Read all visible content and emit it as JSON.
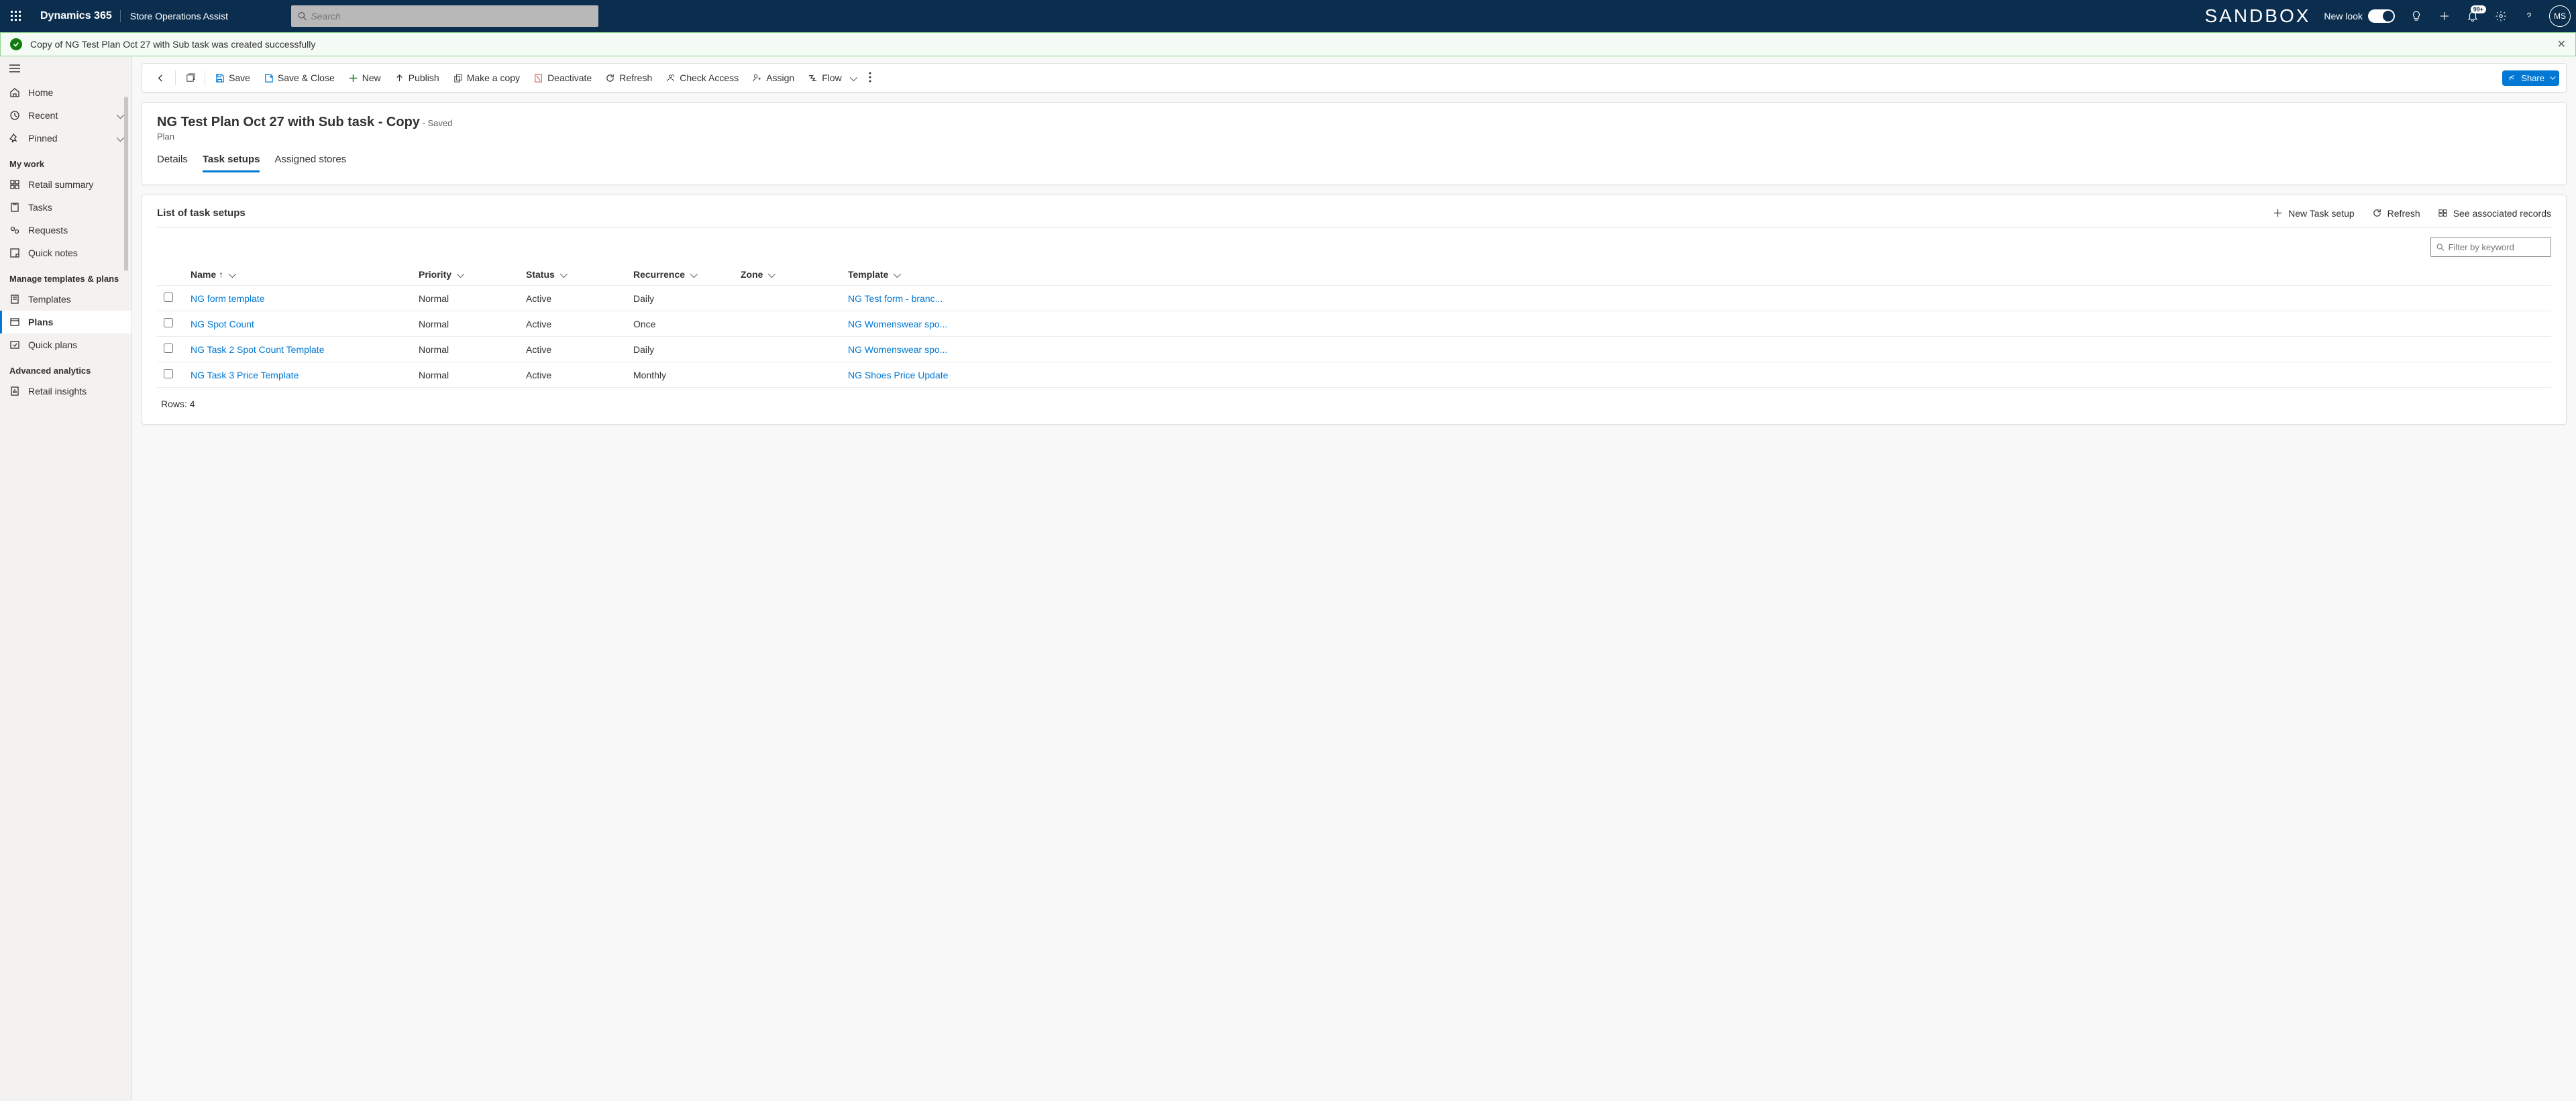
{
  "brand": "Dynamics 365",
  "app_name": "Store Operations Assist",
  "search_placeholder": "Search",
  "sandbox": "SANDBOX",
  "new_look": "New look",
  "notification_badge": "99+",
  "user_initials": "MS",
  "success_message": "Copy of NG Test Plan Oct 27 with Sub task was created successfully",
  "nav": {
    "home": "Home",
    "recent": "Recent",
    "pinned": "Pinned",
    "my_work_header": "My work",
    "retail_summary": "Retail summary",
    "tasks": "Tasks",
    "requests": "Requests",
    "quick_notes": "Quick notes",
    "manage_header": "Manage templates & plans",
    "templates": "Templates",
    "plans": "Plans",
    "quick_plans": "Quick plans",
    "advanced_header": "Advanced analytics",
    "retail_insights": "Retail insights"
  },
  "cmd": {
    "save": "Save",
    "save_close": "Save & Close",
    "new": "New",
    "publish": "Publish",
    "make_copy": "Make a copy",
    "deactivate": "Deactivate",
    "refresh": "Refresh",
    "check_access": "Check Access",
    "assign": "Assign",
    "flow": "Flow",
    "share": "Share"
  },
  "record": {
    "title": "NG Test Plan Oct 27 with Sub task - Copy",
    "status": "- Saved",
    "entity": "Plan"
  },
  "tabs": {
    "details": "Details",
    "task_setups": "Task setups",
    "assigned_stores": "Assigned stores"
  },
  "list": {
    "title": "List of task setups",
    "new_task": "New Task setup",
    "refresh": "Refresh",
    "see_assoc": "See associated records",
    "filter_placeholder": "Filter by keyword",
    "cols": {
      "name": "Name",
      "priority": "Priority",
      "status": "Status",
      "recurrence": "Recurrence",
      "zone": "Zone",
      "template": "Template"
    },
    "rows": [
      {
        "name": "NG form template",
        "priority": "Normal",
        "status": "Active",
        "recurrence": "Daily",
        "zone": "",
        "template": "NG Test form - branc..."
      },
      {
        "name": "NG Spot Count",
        "priority": "Normal",
        "status": "Active",
        "recurrence": "Once",
        "zone": "",
        "template": "NG Womenswear spo..."
      },
      {
        "name": "NG Task 2 Spot Count Template",
        "priority": "Normal",
        "status": "Active",
        "recurrence": "Daily",
        "zone": "",
        "template": "NG Womenswear spo..."
      },
      {
        "name": "NG Task 3 Price Template",
        "priority": "Normal",
        "status": "Active",
        "recurrence": "Monthly",
        "zone": "",
        "template": "NG Shoes Price Update"
      }
    ],
    "rows_label": "Rows: 4"
  }
}
